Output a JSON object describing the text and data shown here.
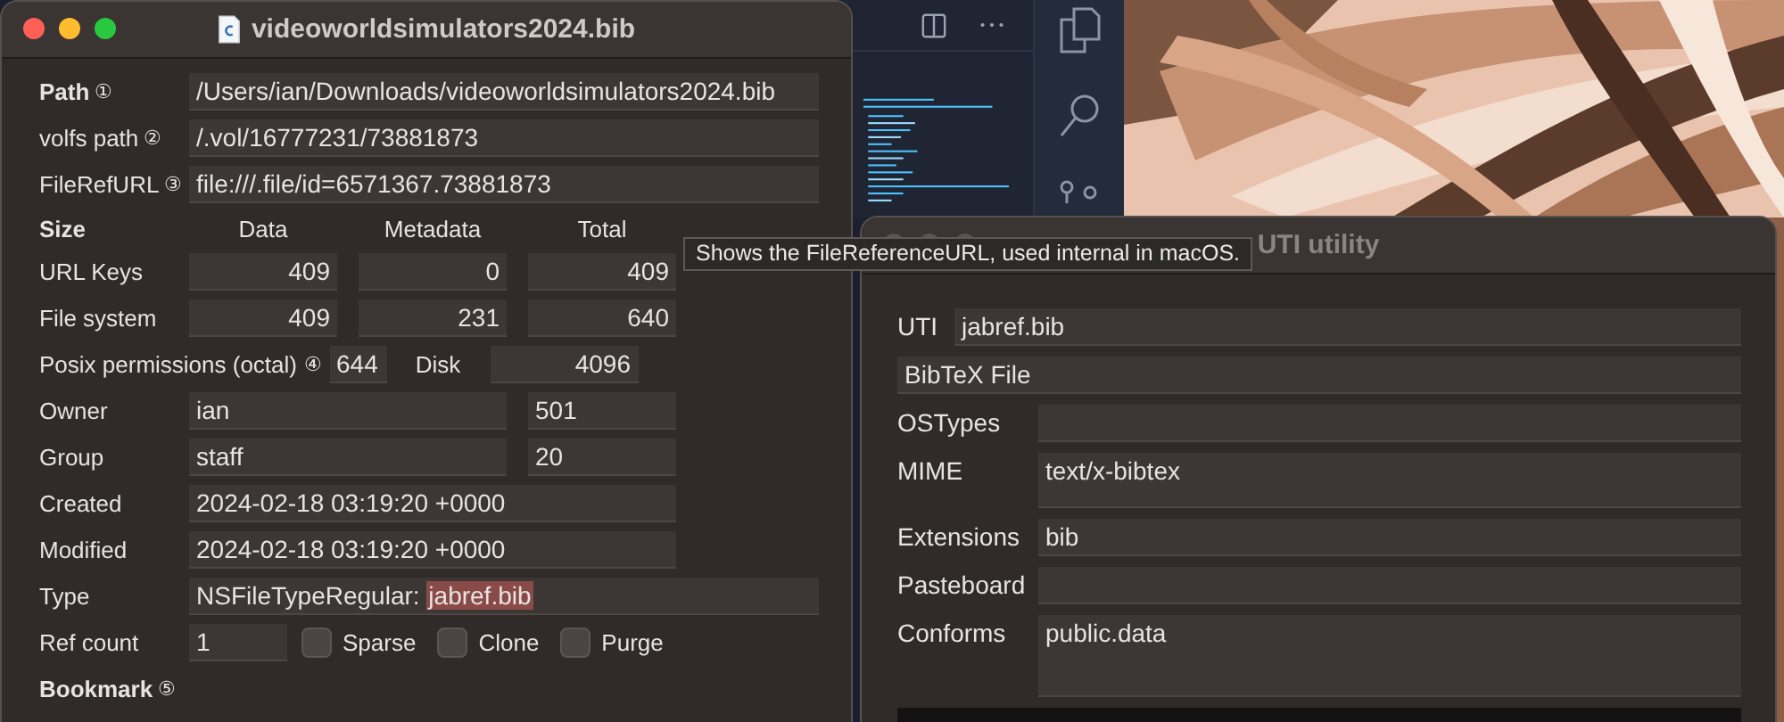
{
  "file_window": {
    "title": "videoworldsimulators2024.bib",
    "active": true,
    "path_rows": [
      {
        "label": "Path",
        "bold": true,
        "info": "①",
        "value": "/Users/ian/Downloads/videoworldsimulators2024.bib"
      },
      {
        "label": "volfs path",
        "bold": false,
        "info": "②",
        "value": "/.vol/16777231/73881873"
      },
      {
        "label": "FileRefURL",
        "bold": false,
        "info": "③",
        "value": "file:///.file/id=6571367.73881873"
      }
    ],
    "size": {
      "label": "Size",
      "columns": [
        "Data",
        "Metadata",
        "Total"
      ],
      "rows": [
        {
          "label": "URL Keys",
          "values": [
            "409",
            "0",
            "409"
          ]
        },
        {
          "label": "File system",
          "values": [
            "409",
            "231",
            "640"
          ]
        }
      ]
    },
    "posix": {
      "label": "Posix permissions (octal)",
      "info": "④",
      "value": "644",
      "disk_label": "Disk",
      "disk_value": "4096"
    },
    "ids": [
      {
        "label": "Owner",
        "name": "ian",
        "id": "501"
      },
      {
        "label": "Group",
        "name": "staff",
        "id": "20"
      }
    ],
    "dates": [
      {
        "label": "Created",
        "value": "2024-02-18 03:19:20 +0000"
      },
      {
        "label": "Modified",
        "value": "2024-02-18 03:19:20 +0000"
      }
    ],
    "type": {
      "label": "Type",
      "value": "NSFileTypeRegular:",
      "selected_text": "jabref.bib"
    },
    "ref_count": {
      "label": "Ref count",
      "value": "1"
    },
    "flags": [
      {
        "label": "Sparse",
        "checked": false
      },
      {
        "label": "Clone",
        "checked": false
      },
      {
        "label": "Purge",
        "checked": false
      }
    ],
    "bookmark": {
      "label": "Bookmark",
      "info": "⑤"
    }
  },
  "tooltip": "Shows the FileReferenceURL, used internal in macOS.",
  "uti_window": {
    "title": "UTI utility",
    "active": false,
    "fields": [
      {
        "kind": "compact",
        "label": "UTI",
        "value": "jabref.bib"
      },
      {
        "kind": "plain",
        "value": "BibTeX File"
      },
      {
        "kind": "line",
        "label": "OSTypes"
      },
      {
        "kind": "tall",
        "label": "MIME",
        "value": "text/x-bibtex"
      },
      {
        "kind": "line",
        "label": "Extensions",
        "value": "bib"
      },
      {
        "kind": "line",
        "label": "Pasteboard"
      },
      {
        "kind": "taller",
        "label": "Conforms",
        "value": "public.data"
      }
    ]
  }
}
